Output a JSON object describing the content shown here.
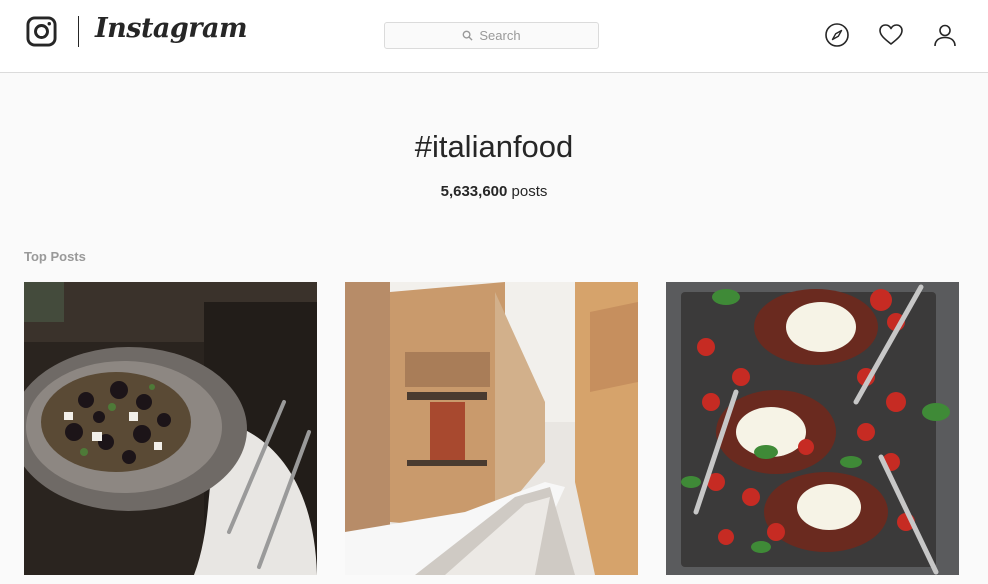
{
  "header": {
    "brand": "Instagram",
    "search": {
      "placeholder": "Search"
    },
    "nav": [
      {
        "icon": "compass-icon",
        "label": "Explore"
      },
      {
        "icon": "heart-icon",
        "label": "Activity"
      },
      {
        "icon": "person-icon",
        "label": "Profile"
      }
    ]
  },
  "hashtag": {
    "title": "#italianfood",
    "count": "5,633,600",
    "count_suffix": " posts"
  },
  "sections": {
    "top_posts_label": "Top Posts"
  },
  "posts": [
    {
      "icon": "photo-bowl-salad-blackberries"
    },
    {
      "icon": "photo-snowy-italian-street"
    },
    {
      "icon": "photo-tray-eggplant-tomatoes"
    }
  ],
  "colors": {
    "background": "#fafafa",
    "header_bg": "#ffffff",
    "border": "#dbdbdb",
    "text": "#262626",
    "muted": "#999999"
  }
}
